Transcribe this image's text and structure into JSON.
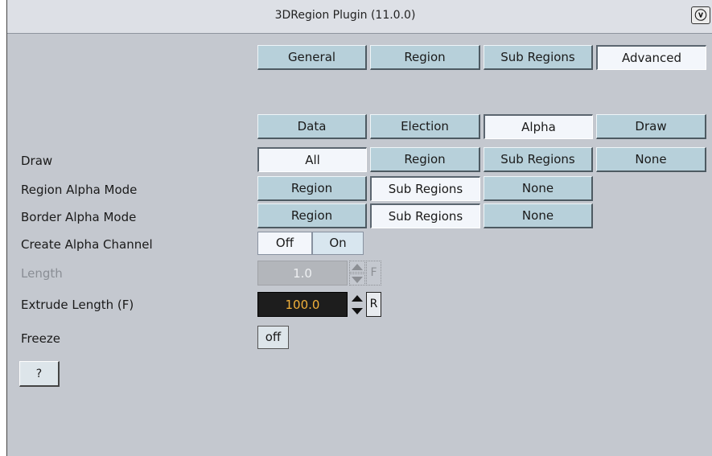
{
  "window": {
    "title": "3DRegion Plugin (11.0.0)",
    "app_icon_glyph": "ⓥ"
  },
  "main_tabs": [
    {
      "label": "General",
      "active": false
    },
    {
      "label": "Region",
      "active": false
    },
    {
      "label": "Sub Regions",
      "active": false
    },
    {
      "label": "Advanced",
      "active": true
    }
  ],
  "sub_tabs": [
    {
      "label": "Data",
      "active": false
    },
    {
      "label": "Election",
      "active": false
    },
    {
      "label": "Alpha",
      "active": true
    },
    {
      "label": "Draw",
      "active": false
    }
  ],
  "draw": {
    "label": "Draw",
    "options": [
      {
        "label": "All",
        "active": true
      },
      {
        "label": "Region",
        "active": false
      },
      {
        "label": "Sub Regions",
        "active": false
      },
      {
        "label": "None",
        "active": false
      }
    ]
  },
  "region_alpha_mode": {
    "label": "Region Alpha Mode",
    "options": [
      {
        "label": "Region",
        "active": false
      },
      {
        "label": "Sub Regions",
        "active": true
      },
      {
        "label": "None",
        "active": false
      }
    ]
  },
  "border_alpha_mode": {
    "label": "Border Alpha Mode",
    "options": [
      {
        "label": "Region",
        "active": false
      },
      {
        "label": "Sub Regions",
        "active": true
      },
      {
        "label": "None",
        "active": false
      }
    ]
  },
  "create_alpha_channel": {
    "label": "Create Alpha Channel",
    "options": [
      {
        "label": "Off",
        "active": true
      },
      {
        "label": "On",
        "active": false
      }
    ]
  },
  "length": {
    "label": "Length",
    "value": "1.0",
    "reset_label": "F",
    "enabled": false
  },
  "extrude_length": {
    "label": "Extrude Length (F)",
    "value": "100.0",
    "reset_label": "R"
  },
  "freeze": {
    "label": "Freeze",
    "value": "off"
  },
  "help_label": "?",
  "colors": {
    "panel_bg": "#c4c8cf",
    "button_bg": "#b7d0da",
    "active_button_bg": "#f3f6fb",
    "dark_field_bg": "#1d1d1d",
    "dark_field_text": "#f2b13a"
  }
}
